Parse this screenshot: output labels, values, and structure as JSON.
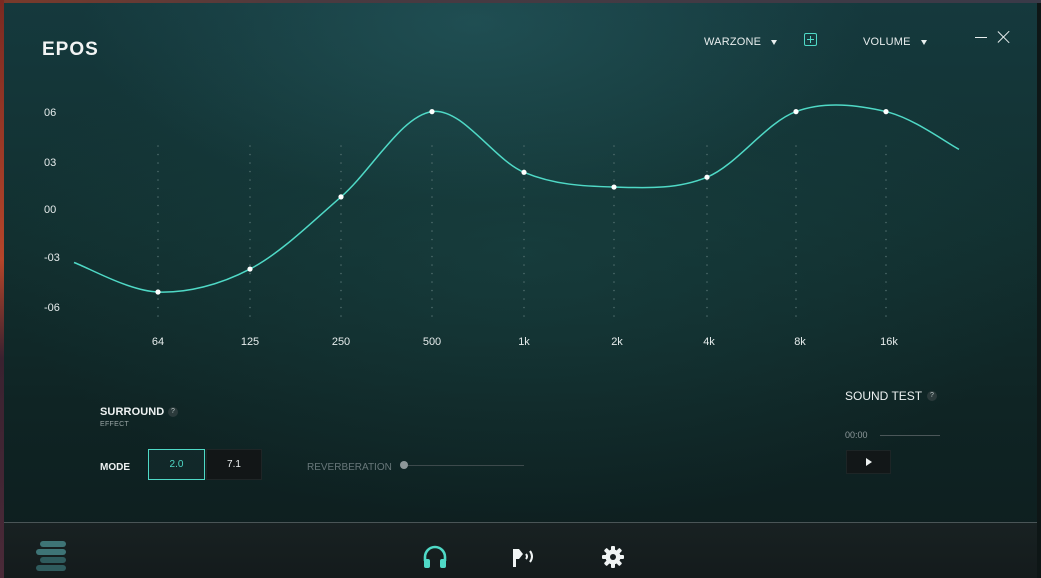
{
  "app": {
    "logo": "EPOS",
    "profile_label": "WARZONE",
    "volume_label": "VOLUME"
  },
  "equalizer": {
    "y_labels": [
      "06",
      "03",
      "00",
      "-03",
      "-06"
    ],
    "x_labels": [
      "64",
      "125",
      "250",
      "500",
      "1k",
      "2k",
      "4k",
      "8k",
      "16k"
    ],
    "band_gains_db": [
      -5.0,
      -3.6,
      0.8,
      6.0,
      2.3,
      1.4,
      2.0,
      6.0,
      6.0
    ],
    "curve_color": "#4fd9c6",
    "point_color": "#ffffff"
  },
  "surround": {
    "title": "SURROUND",
    "subtitle": "EFFECT",
    "help": "?",
    "mode_label": "MODE",
    "modes": [
      "2.0",
      "7.1"
    ],
    "selected_mode": "2.0",
    "reverb_label": "REVERBERATION",
    "reverb_level": 0
  },
  "sound_test": {
    "title": "SOUND TEST",
    "help": "?",
    "time": "00:00"
  },
  "nav": {
    "items": [
      "menu-icon",
      "headphones-icon",
      "microphone-icon",
      "gear-icon"
    ],
    "active": "headphones-icon"
  },
  "colors": {
    "accent": "#4fd9c6",
    "text": "#eef2f2",
    "muted": "#68777a"
  }
}
